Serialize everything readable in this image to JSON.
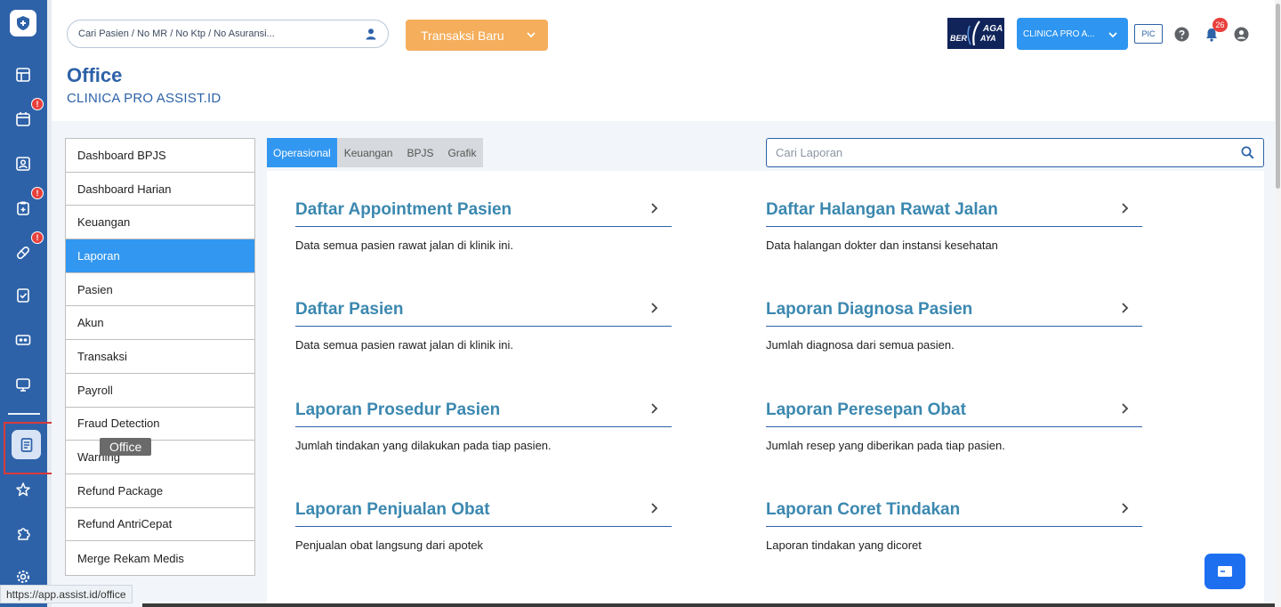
{
  "topbar": {
    "search_placeholder": "Cari Pasien / No MR / No Ktp / No Asuransi...",
    "new_transaction_label": "Transaksi Baru",
    "brand_logo_text": "JAGA BERDAYA",
    "clinic_select_value": "CLINICA PRO A...",
    "pic_label": "PIC",
    "notification_count": "26"
  },
  "page": {
    "title": "Office",
    "subtitle": "CLINICA PRO ASSIST.ID"
  },
  "sidebar": {
    "alerts": [
      "!",
      "!",
      "!"
    ],
    "tooltip": "Office"
  },
  "menu": {
    "items": [
      "Dashboard BPJS",
      "Dashboard Harian",
      "Keuangan",
      "Laporan",
      "Pasien",
      "Akun",
      "Transaksi",
      "Payroll",
      "Fraud Detection",
      "Warning",
      "Refund Package",
      "Refund AntriCepat",
      "Merge Rekam Medis"
    ],
    "active": "Laporan"
  },
  "tabs": [
    "Operasional",
    "Keuangan",
    "BPJS",
    "Grafik"
  ],
  "report_search_placeholder": "Cari Laporan",
  "reports": [
    {
      "title": "Daftar Appointment Pasien",
      "desc": "Data semua pasien rawat jalan di klinik ini."
    },
    {
      "title": "Daftar Halangan Rawat Jalan",
      "desc": "Data halangan dokter dan instansi kesehatan"
    },
    {
      "title": "Daftar Pasien",
      "desc": "Data semua pasien rawat jalan di klinik ini."
    },
    {
      "title": "Laporan Diagnosa Pasien",
      "desc": "Jumlah diagnosa dari semua pasien."
    },
    {
      "title": "Laporan Prosedur Pasien",
      "desc": "Jumlah tindakan yang dilakukan pada tiap pasien."
    },
    {
      "title": "Laporan Peresepan Obat",
      "desc": "Jumlah resep yang diberikan pada tiap pasien."
    },
    {
      "title": "Laporan Penjualan Obat",
      "desc": "Penjualan obat langsung dari apotek"
    },
    {
      "title": "Laporan Coret Tindakan",
      "desc": "Laporan tindakan yang dicoret"
    }
  ],
  "status_url": "https://app.assist.id/office",
  "colors": {
    "sidebar": "#2e62a8",
    "primary": "#2d62a8",
    "accent_blue": "#3297f0",
    "orange_button": "#f5ae5b",
    "report_title": "#3b88b0",
    "badge_red": "#e8403c"
  }
}
